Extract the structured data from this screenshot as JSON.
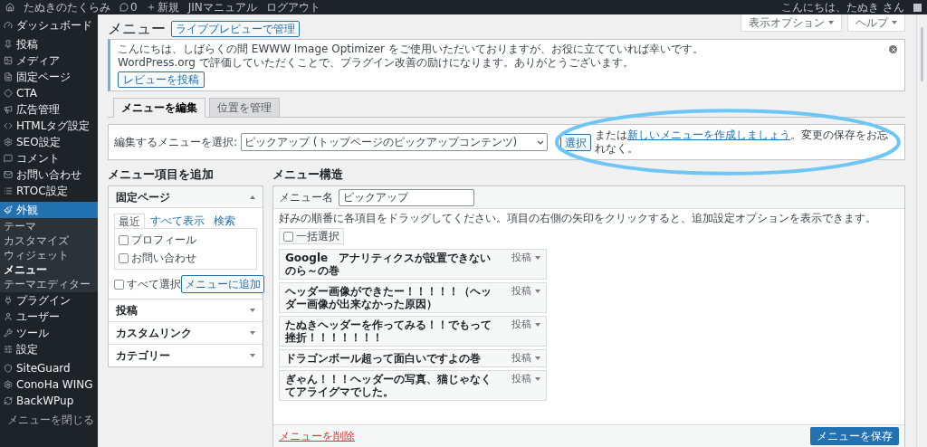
{
  "admin_bar": {
    "site": "たぬきのたくらみ",
    "comments": "0",
    "new": "新規",
    "links": [
      "JINマニュアル",
      "ログアウト"
    ],
    "greeting": "こんにちは、たぬき さん"
  },
  "sidebar": {
    "groups": [
      [
        {
          "label": "ダッシュボード",
          "selected": false
        }
      ],
      [
        {
          "label": "投稿",
          "selected": false
        },
        {
          "label": "メディア",
          "selected": false
        },
        {
          "label": "固定ページ",
          "selected": false
        },
        {
          "label": "CTA",
          "selected": false
        },
        {
          "label": "広告管理",
          "selected": false
        },
        {
          "label": "HTMLタグ設定",
          "selected": false
        },
        {
          "label": "SEO設定",
          "selected": false
        },
        {
          "label": "コメント",
          "selected": false
        },
        {
          "label": "お問い合わせ",
          "selected": false
        },
        {
          "label": "RTOC設定",
          "selected": false
        }
      ],
      [
        {
          "label": "外観",
          "selected": true,
          "submenu": [
            {
              "label": "テーマ",
              "selected": false
            },
            {
              "label": "カスタマイズ",
              "selected": false
            },
            {
              "label": "ウィジェット",
              "selected": false
            },
            {
              "label": "メニュー",
              "selected": true
            },
            {
              "label": "テーマエディター",
              "selected": false
            }
          ]
        },
        {
          "label": "プラグイン",
          "selected": false
        },
        {
          "label": "ユーザー",
          "selected": false
        },
        {
          "label": "ツール",
          "selected": false
        },
        {
          "label": "設定",
          "selected": false
        }
      ],
      [
        {
          "label": "SiteGuard",
          "selected": false
        },
        {
          "label": "ConoHa WING",
          "selected": false
        },
        {
          "label": "BackWPup",
          "selected": false
        }
      ]
    ],
    "collapse": "メニューを閉じる"
  },
  "screen_buttons": [
    "表示オプション",
    "ヘルプ"
  ],
  "page_title": "メニュー",
  "live_preview": "ライブプレビューで管理",
  "notice": {
    "lines": [
      "こんにちは、しばらくの間 EWWW Image Optimizer をご使用いただいておりますが、お役に立てていれば幸いです。",
      "WordPress.org で評価していただくことで、プラグイン改善の励けになります。ありがとうございます。"
    ],
    "button": "レビューを投稿"
  },
  "tabs": [
    {
      "label": "メニューを編集",
      "selected": true
    },
    {
      "label": "位置を管理",
      "selected": false
    }
  ],
  "select_bar": {
    "label": "編集するメニューを選択:",
    "value": "ピックアップ (トップページのピックアップコンテンツ)",
    "button": "選択",
    "before": "または",
    "link": "新しいメニューを作成しましょう",
    "after": "。変更の保存をお忘れなく。"
  },
  "add_items": {
    "heading": "メニュー項目を追加",
    "sections": [
      {
        "title": "固定ページ",
        "expanded": true,
        "tabs": [
          {
            "label": "最近",
            "selected": true
          },
          {
            "label": "すべて表示",
            "selected": false
          },
          {
            "label": "検索",
            "selected": false
          }
        ],
        "items": [
          {
            "label": "プロフィール",
            "checked": false
          },
          {
            "label": "お問い合わせ",
            "checked": false
          }
        ],
        "select_all": {
          "label": "すべて選択",
          "checked": false
        },
        "button": "メニューに追加"
      },
      {
        "title": "投稿",
        "expanded": false
      },
      {
        "title": "カスタムリンク",
        "expanded": false
      },
      {
        "title": "カテゴリー",
        "expanded": false
      }
    ]
  },
  "structure": {
    "heading": "メニュー構造",
    "name_label": "メニュー名",
    "name_value": "ピックアップ",
    "instructions": "好みの順番に各項目をドラッグしてください。項目の右側の矢印をクリックすると、追加設定オプションを表示できます。",
    "bulk_select": {
      "label": "一括選択",
      "checked": false
    },
    "items": [
      {
        "title": "Google　アナリティクスが設置できないのら～の巻",
        "type": "投稿"
      },
      {
        "title": "ヘッダー画像ができたー！！！！！（ヘッダー画像が出来なかった原因）",
        "type": "投稿"
      },
      {
        "title": "たぬきヘッダーを作ってみる！！でもって挫折！！！！！！！",
        "type": "投稿"
      },
      {
        "title": "ドラゴンボール超って面白いですよの巻",
        "type": "投稿"
      },
      {
        "title": "ぎゃん！！！ヘッダーの写真、猫じゃなくてアライグマでした。",
        "type": "投稿"
      }
    ],
    "delete": "メニューを削除",
    "save": "メニューを保存"
  }
}
